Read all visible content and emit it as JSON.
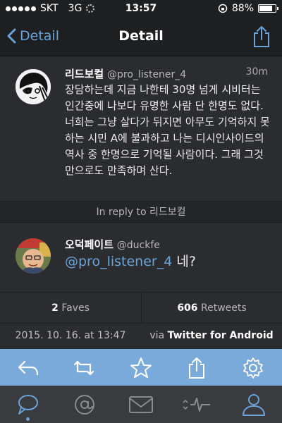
{
  "status_bar": {
    "carrier": "SKT",
    "network": "3G",
    "time": "13:57",
    "battery": "88%",
    "battery_level": 0.88
  },
  "nav": {
    "back_label": "Detail",
    "title": "Detail"
  },
  "tweet": {
    "display_name": "리드보컬",
    "handle": "@pro_listener_4",
    "time_ago": "30m",
    "text": "장담하는데 지금 나한테 30명 넘게 시비터는 인간중에 나보다 유명한 사람 단 한명도 없다. 너희는 그냥 살다가 뒤지면 아무도 기억하지 못하는 시민 A에 불과하고 나는 디시인사이드의 역사 중 한명으로 기억될 사람이다. 그래 그것만으로도 만족하며 산다."
  },
  "in_reply_to": "In reply to 리드보컬",
  "reply": {
    "display_name": "오덕페이트",
    "handle": "@duckfe",
    "mention": "@pro_listener_4",
    "text": " 네?"
  },
  "stats": {
    "faves_count": "2",
    "faves_label": "Faves",
    "retweets_count": "606",
    "retweets_label": "Retweets"
  },
  "meta": {
    "date": "2015. 10. 16. at 13:47",
    "via": "via",
    "client": "Twitter for Android"
  },
  "actions": [
    "reply-icon",
    "retweet-icon",
    "star-icon",
    "share-icon",
    "gear-icon"
  ],
  "tabs": [
    "speech-bubble-icon",
    "at-icon",
    "envelope-icon",
    "activity-icon",
    "profile-icon"
  ],
  "colors": {
    "accent": "#6aa3d8",
    "action_bar": "#7aaad9",
    "background": "#2b2c2f"
  }
}
